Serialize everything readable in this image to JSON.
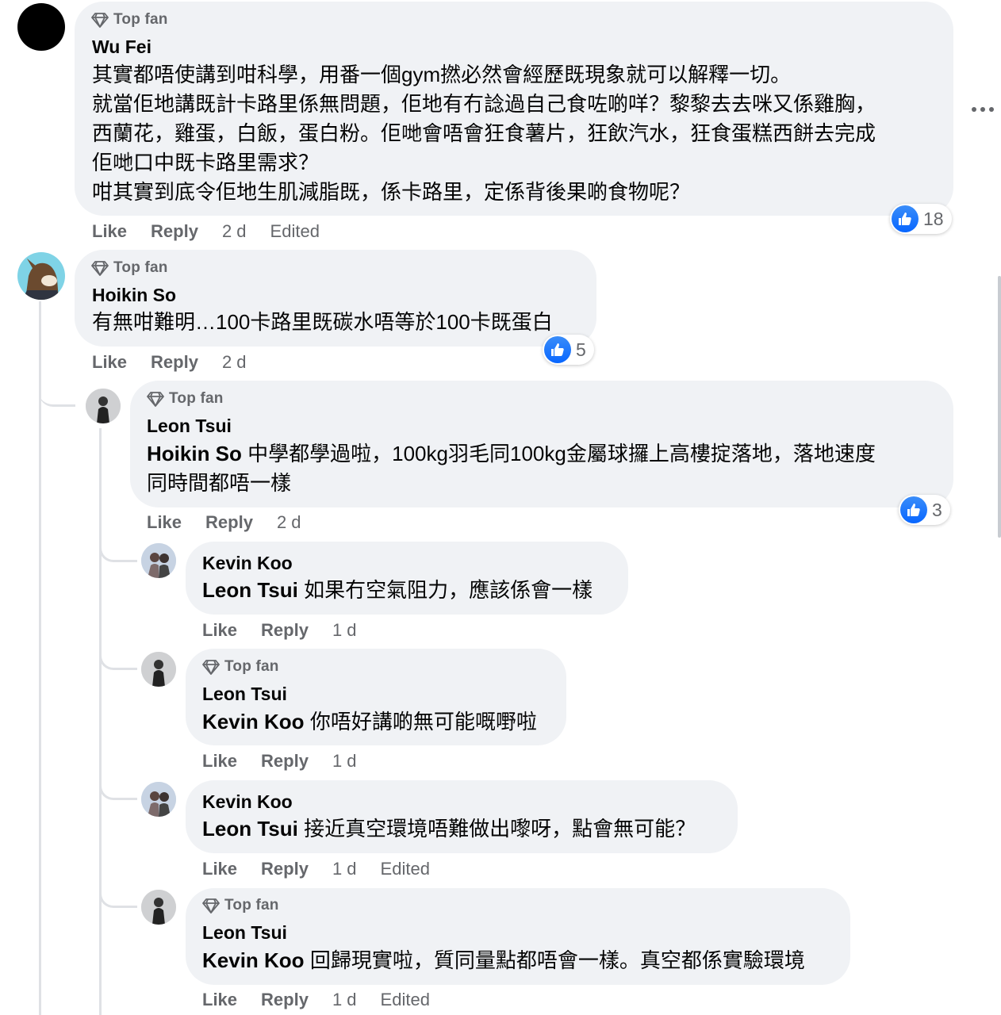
{
  "badge_label": "Top fan",
  "comments": [
    {
      "author": "Wu Fei",
      "lines": [
        "其實都唔使講到咁科學，用番一個gym撚必然會經歷既現象就可以解釋一切。",
        "就當佢地講既計卡路里係無問題，佢地有冇諗過自己食咗啲咩？黎黎去去咪又係雞胸，",
        "西蘭花，雞蛋，白飯，蛋白粉。佢哋會唔會狂食薯片，狂飲汽水，狂食蛋糕西餅去完成",
        "佢哋口中既卡路里需求？",
        "咁其實到底令佢地生肌減脂既，係卡路里，定係背後果啲食物呢？"
      ],
      "like": "Like",
      "reply": "Reply",
      "time": "2 d",
      "edited": "Edited",
      "reactions": "18"
    },
    {
      "author": "Hoikin So",
      "lines": [
        "有無咁難明…100卡路里既碳水唔等於100卡既蛋白"
      ],
      "like": "Like",
      "reply": "Reply",
      "time": "2 d",
      "reactions": "5"
    },
    {
      "author": "Leon Tsui",
      "mention": "Hoikin So",
      "line1": "中學都學過啦，100kg羽毛同100kg金屬球攞上高樓掟落地，落地速度",
      "line2": "同時間都唔一樣",
      "like": "Like",
      "reply": "Reply",
      "time": "2 d",
      "reactions": "3"
    },
    {
      "author": "Kevin Koo",
      "mention": "Leon Tsui",
      "text": "如果冇空氣阻力，應該係會一樣",
      "like": "Like",
      "reply": "Reply",
      "time": "1 d"
    },
    {
      "author": "Leon Tsui",
      "mention": "Kevin Koo",
      "text": "你唔好講啲無可能嘅嘢啦",
      "like": "Like",
      "reply": "Reply",
      "time": "1 d"
    },
    {
      "author": "Kevin Koo",
      "mention": "Leon Tsui",
      "text": "接近真空環境唔難做出嚟呀，點會無可能？",
      "like": "Like",
      "reply": "Reply",
      "time": "1 d",
      "edited": "Edited"
    },
    {
      "author": "Leon Tsui",
      "mention": "Kevin Koo",
      "text": "回歸現實啦，質同量點都唔會一樣。真空都係實驗環境",
      "like": "Like",
      "reply": "Reply",
      "time": "1 d",
      "edited": "Edited"
    }
  ],
  "colors": {
    "bubble": "#f0f2f5",
    "meta": "#65676b",
    "like_blue": "#0866ff"
  },
  "icons": {
    "badge": "diamond-icon",
    "reaction": "thumbs-up-icon",
    "menu": "more-options-icon"
  }
}
